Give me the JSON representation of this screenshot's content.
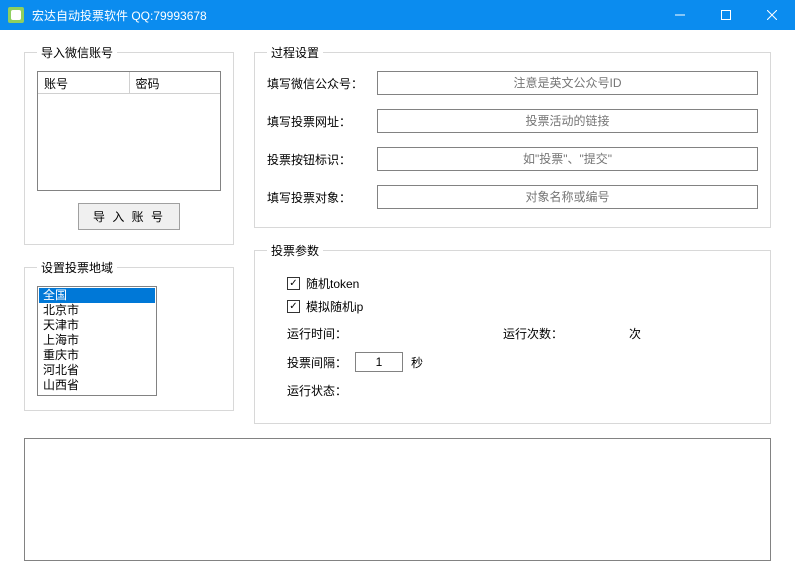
{
  "titlebar": {
    "title": "宏达自动投票软件   QQ:79993678"
  },
  "import_accounts": {
    "legend": "导入微信账号",
    "col_account": "账号",
    "col_password": "密码",
    "import_btn": "导 入  账 号"
  },
  "regions": {
    "legend": "设置投票地域",
    "items": [
      "全国",
      "北京市",
      "天津市",
      "上海市",
      "重庆市",
      "河北省",
      "山西省"
    ],
    "selected_index": 0
  },
  "process": {
    "legend": "过程设置",
    "rows": [
      {
        "label": "填写微信公众号：",
        "placeholder": "注意是英文公众号ID"
      },
      {
        "label": "填写投票网址：",
        "placeholder": "投票活动的链接"
      },
      {
        "label": "投票按钮标识：",
        "placeholder": "如\"投票\"、\"提交\""
      },
      {
        "label": "填写投票对象：",
        "placeholder": "对象名称或编号"
      }
    ]
  },
  "params": {
    "legend": "投票参数",
    "chk_token": "随机token",
    "chk_ip": "模拟随机ip",
    "runtime_label": "运行时间：",
    "runcount_label": "运行次数：",
    "runcount_unit": "次",
    "interval_label": "投票间隔：",
    "interval_value": "1",
    "interval_unit": "秒",
    "status_label": "运行状态："
  }
}
